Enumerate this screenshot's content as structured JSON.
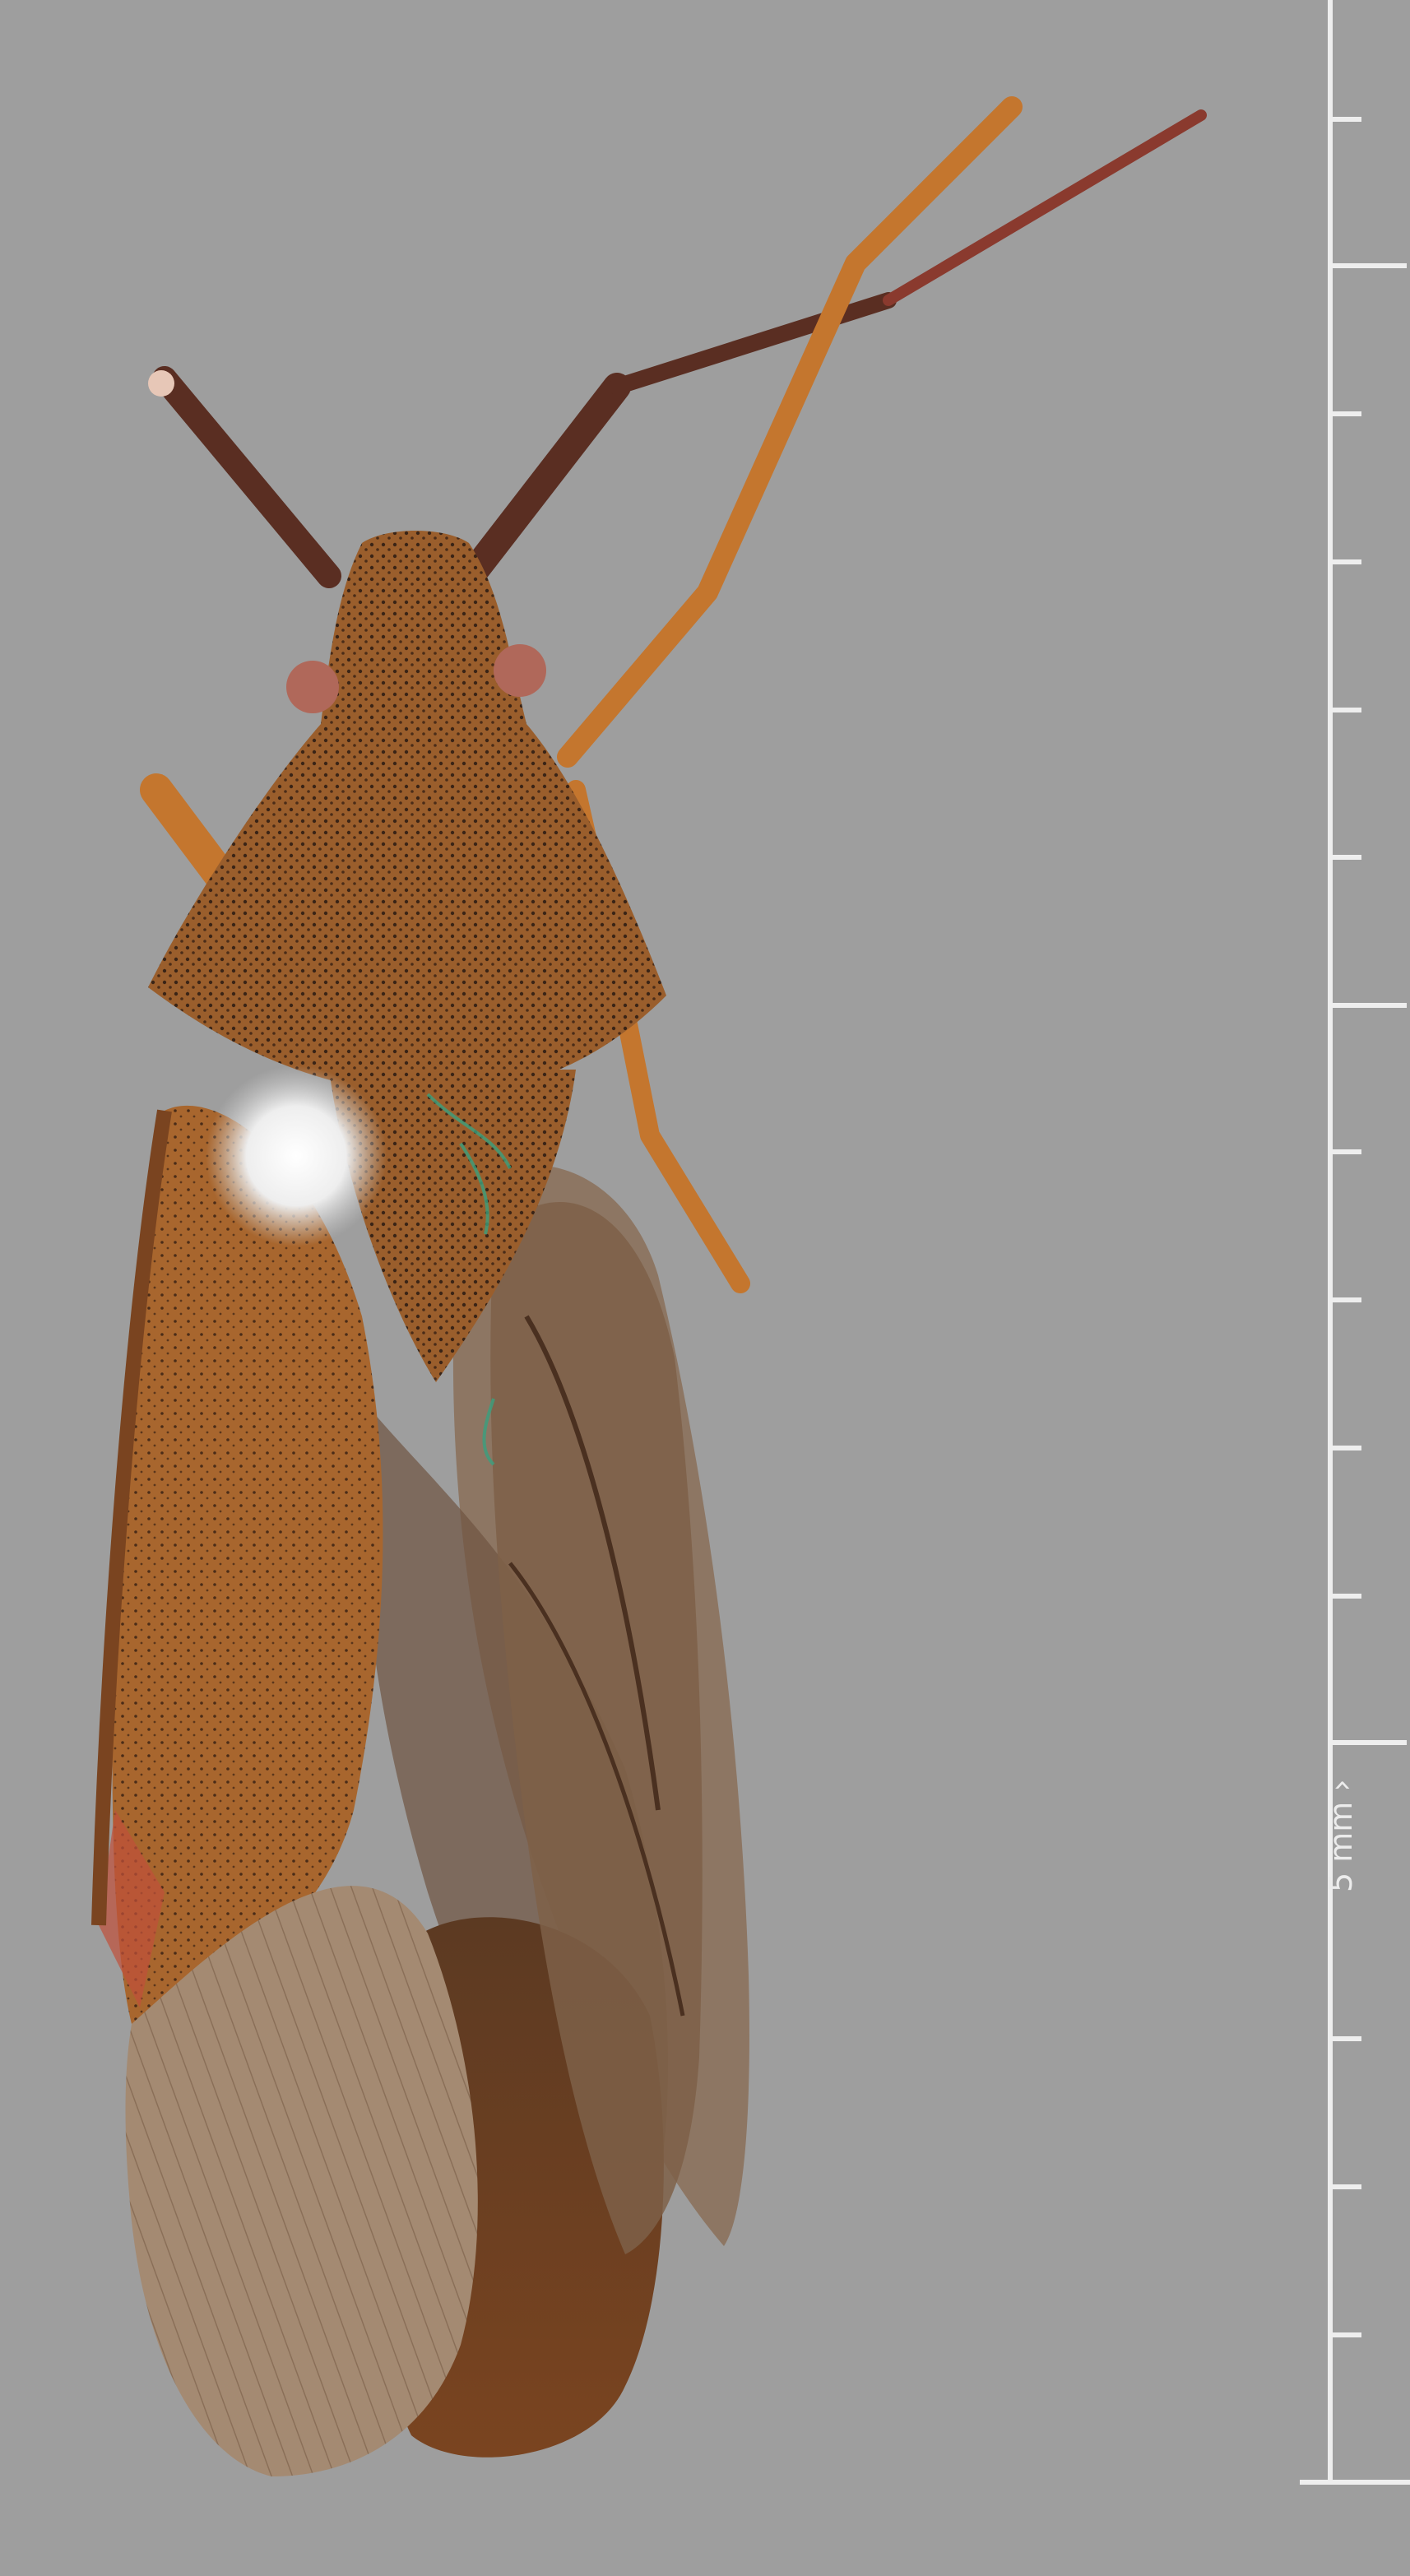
{
  "image": {
    "subject": "insect-specimen",
    "background_color": "#9e9e9e"
  },
  "scale_bar": {
    "label": "5 mm ›",
    "color": "#eeeeee"
  },
  "colors": {
    "body": "#9a5e2c",
    "body_dark": "#6f3f1c",
    "antenna": "#5a2e22",
    "antenna_tip": "#8a3a2e",
    "leg": "#c4762e",
    "wing_membrane": "#a48a72",
    "wing_dark": "#5c3f2a",
    "glare": "#f4f4f4"
  }
}
